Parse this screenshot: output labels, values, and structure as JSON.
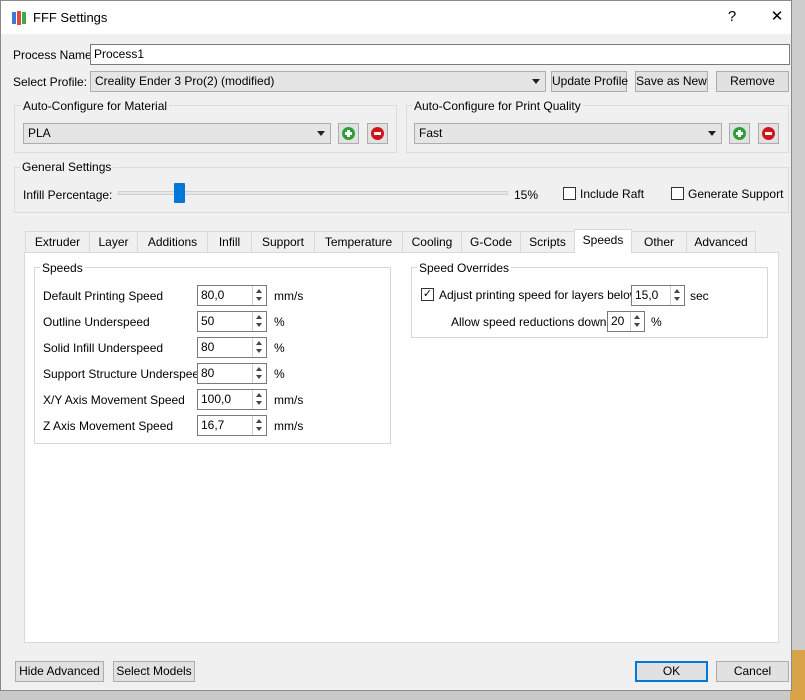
{
  "window": {
    "title": "FFF Settings",
    "help": "?",
    "close": "✕"
  },
  "process": {
    "label": "Process Name:",
    "value": "Process1"
  },
  "profile": {
    "label": "Select Profile:",
    "value": "Creality Ender 3 Pro(2) (modified)",
    "update": "Update Profile",
    "save_as_new": "Save as New",
    "remove": "Remove"
  },
  "material": {
    "title": "Auto-Configure for Material",
    "value": "PLA"
  },
  "quality": {
    "title": "Auto-Configure for Print Quality",
    "value": "Fast"
  },
  "general": {
    "title": "General Settings",
    "infill_label": "Infill Percentage:",
    "infill_value": "15%",
    "infill_fraction": 0.15,
    "include_raft": "Include Raft",
    "include_raft_checked": false,
    "generate_support": "Generate Support",
    "generate_support_checked": false
  },
  "tabs": [
    "Extruder",
    "Layer",
    "Additions",
    "Infill",
    "Support",
    "Temperature",
    "Cooling",
    "G-Code",
    "Scripts",
    "Speeds",
    "Other",
    "Advanced"
  ],
  "active_tab": "Speeds",
  "speeds": {
    "title": "Speeds",
    "rows": [
      {
        "label": "Default Printing Speed",
        "value": "80,0",
        "unit": "mm/s"
      },
      {
        "label": "Outline Underspeed",
        "value": "50",
        "unit": "%"
      },
      {
        "label": "Solid Infill Underspeed",
        "value": "80",
        "unit": "%"
      },
      {
        "label": "Support Structure Underspeed",
        "value": "80",
        "unit": "%"
      },
      {
        "label": "X/Y Axis Movement Speed",
        "value": "100,0",
        "unit": "mm/s"
      },
      {
        "label": "Z Axis Movement Speed",
        "value": "16,7",
        "unit": "mm/s"
      }
    ]
  },
  "overrides": {
    "title": "Speed Overrides",
    "adjust_label": "Adjust printing speed for layers below",
    "adjust_checked": true,
    "adjust_value": "15,0",
    "adjust_unit": "sec",
    "reduce_label": "Allow speed reductions down to",
    "reduce_value": "20",
    "reduce_unit": "%"
  },
  "footer": {
    "hide_advanced": "Hide Advanced",
    "select_models": "Select Models",
    "ok": "OK",
    "cancel": "Cancel"
  },
  "colors": {
    "accent": "#0078d7",
    "add": "#2e9e3a",
    "remove": "#d0141b"
  }
}
